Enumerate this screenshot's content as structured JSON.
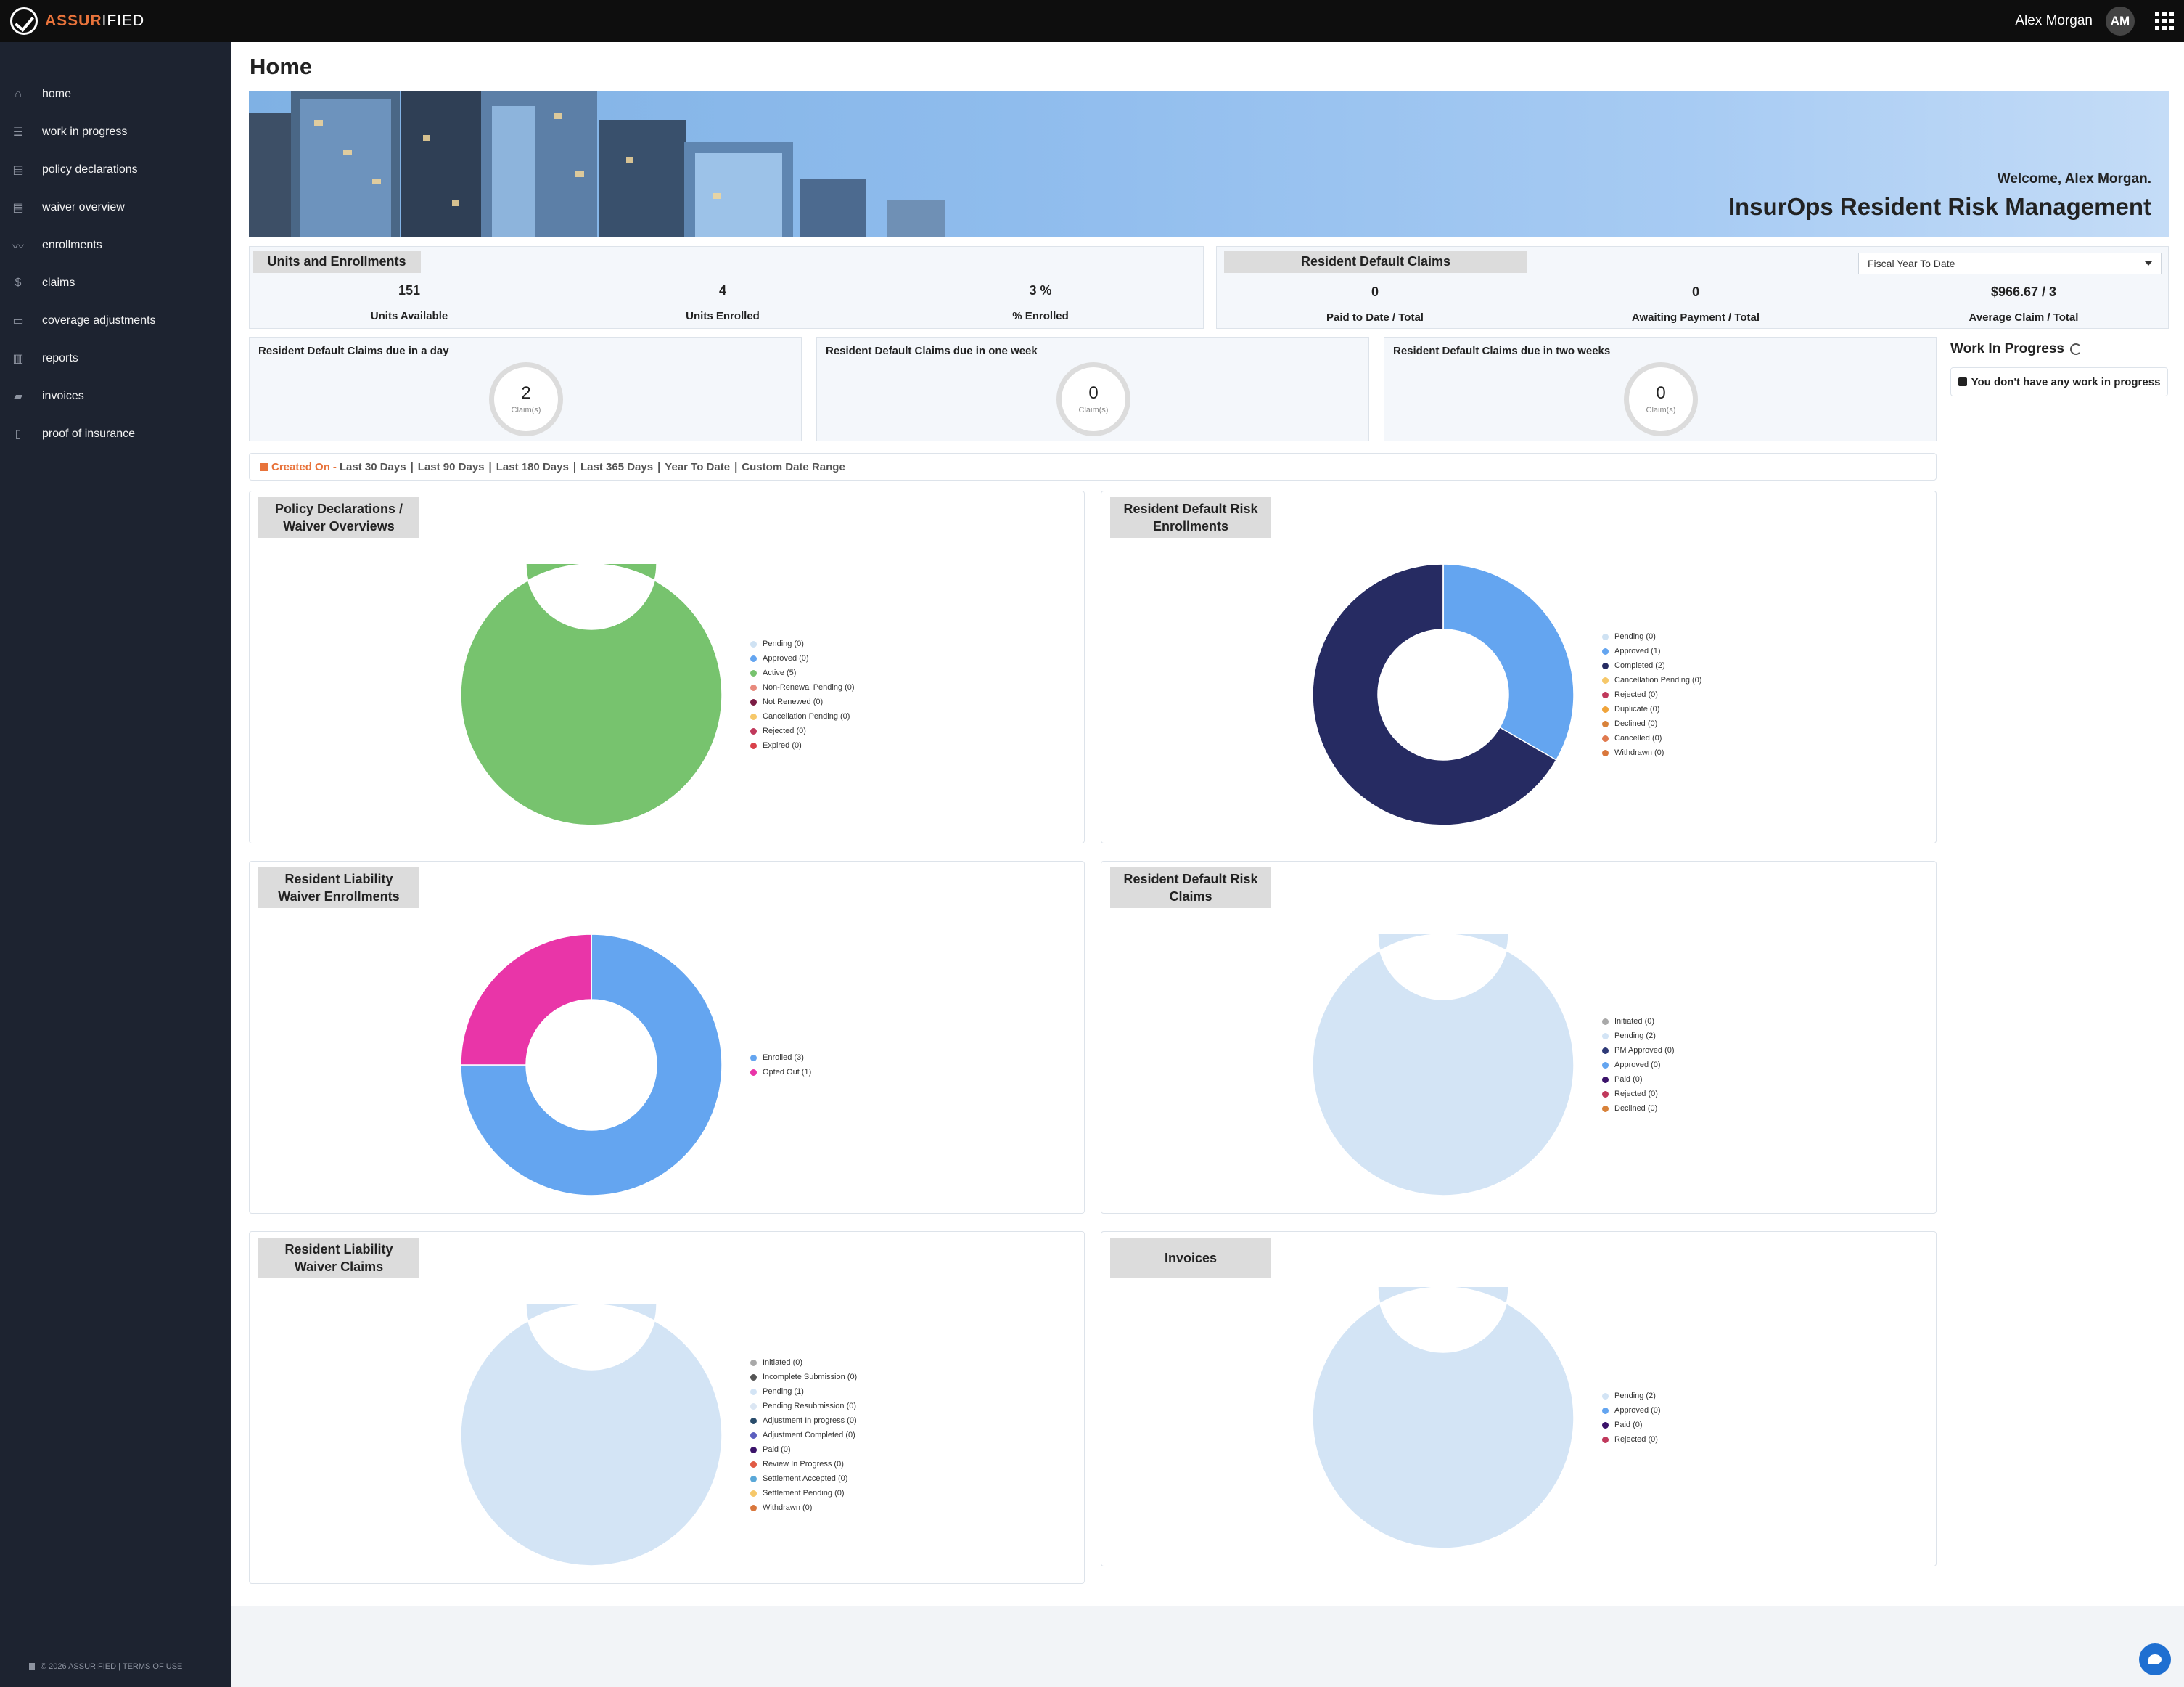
{
  "brand": {
    "part1": "ASSUR",
    "part2": "IFIED"
  },
  "user": {
    "name": "Alex Morgan",
    "initials": "AM"
  },
  "sidebar": {
    "items": [
      {
        "label": "home",
        "icon": "home-icon"
      },
      {
        "label": "work in progress",
        "icon": "list-icon"
      },
      {
        "label": "policy declarations",
        "icon": "document-icon"
      },
      {
        "label": "waiver overview",
        "icon": "document-icon"
      },
      {
        "label": "enrollments",
        "icon": "trend-line-icon"
      },
      {
        "label": "claims",
        "icon": "dollar-icon"
      },
      {
        "label": "coverage adjustments",
        "icon": "card-icon"
      },
      {
        "label": "reports",
        "icon": "bar-chart-icon"
      },
      {
        "label": "invoices",
        "icon": "folder-icon"
      },
      {
        "label": "proof of insurance",
        "icon": "file-icon"
      }
    ],
    "footer": "© 2026 ASSURIFIED | TERMS OF USE"
  },
  "page": {
    "title": "Home"
  },
  "banner": {
    "welcome": "Welcome, Alex Morgan.",
    "title": "InsurOps Resident Risk Management"
  },
  "units": {
    "title": "Units and Enrollments",
    "stats": [
      {
        "value": "151",
        "label": "Units Available"
      },
      {
        "value": "4",
        "label": "Units Enrolled"
      },
      {
        "value": "3 %",
        "label": "% Enrolled"
      }
    ]
  },
  "claims_summary": {
    "title": "Resident Default Claims",
    "period": "Fiscal Year To Date",
    "stats": [
      {
        "value": "0",
        "label": "Paid to Date / Total"
      },
      {
        "value": "0",
        "label": "Awaiting Payment / Total"
      },
      {
        "value": "$966.67 / 3",
        "label": "Average Claim / Total"
      }
    ]
  },
  "due_cards": [
    {
      "title": "Resident Default Claims due in a day",
      "value": "2",
      "unit": "Claim(s)"
    },
    {
      "title": "Resident Default Claims due in one week",
      "value": "0",
      "unit": "Claim(s)"
    },
    {
      "title": "Resident Default Claims due in two weeks",
      "value": "0",
      "unit": "Claim(s)"
    }
  ],
  "wip": {
    "title": "Work In Progress",
    "message": "You don't have any work in progress"
  },
  "filter": {
    "label": "Created On",
    "prefix": "-",
    "options": [
      "Last 30 Days",
      "Last 90 Days",
      "Last 180 Days",
      "Last 365 Days",
      "Year To Date",
      "Custom Date Range"
    ],
    "active": "Year To Date"
  },
  "colors": {
    "accent": "#e8733b",
    "sidebar": "#1d2330",
    "topbar": "#0e0e0e"
  },
  "chart_data": [
    {
      "type": "pie",
      "title": "Policy Declarations / Waiver Overviews",
      "slices": [
        {
          "label": "Pending (0)",
          "value": 0,
          "color": "#cfe2f3"
        },
        {
          "label": "Approved (0)",
          "value": 0,
          "color": "#64a5f0"
        },
        {
          "label": "Active (5)",
          "value": 5,
          "color": "#77c36e"
        },
        {
          "label": "Non-Renewal Pending (0)",
          "value": 0,
          "color": "#e88a7d"
        },
        {
          "label": "Not Renewed (0)",
          "value": 0,
          "color": "#7b1d44"
        },
        {
          "label": "Cancellation Pending (0)",
          "value": 0,
          "color": "#f6c86a"
        },
        {
          "label": "Rejected (0)",
          "value": 0,
          "color": "#c0395c"
        },
        {
          "label": "Expired (0)",
          "value": 0,
          "color": "#d9414a"
        }
      ]
    },
    {
      "type": "pie",
      "title": "Resident Default Risk Enrollments",
      "slices": [
        {
          "label": "Pending (0)",
          "value": 0,
          "color": "#cfe2f3"
        },
        {
          "label": "Approved (1)",
          "value": 1,
          "color": "#64a5f0"
        },
        {
          "label": "Completed (2)",
          "value": 2,
          "color": "#262b62"
        },
        {
          "label": "Cancellation Pending (0)",
          "value": 0,
          "color": "#f6c86a"
        },
        {
          "label": "Rejected (0)",
          "value": 0,
          "color": "#c0395c"
        },
        {
          "label": "Duplicate (0)",
          "value": 0,
          "color": "#f0a43a"
        },
        {
          "label": "Declined (0)",
          "value": 0,
          "color": "#d8823a"
        },
        {
          "label": "Cancelled (0)",
          "value": 0,
          "color": "#e07a4f"
        },
        {
          "label": "Withdrawn (0)",
          "value": 0,
          "color": "#d9773c"
        }
      ]
    },
    {
      "type": "pie",
      "title": "Resident Liability Waiver Enrollments",
      "slices": [
        {
          "label": "Enrolled (3)",
          "value": 3,
          "color": "#64a5f0"
        },
        {
          "label": "Opted Out (1)",
          "value": 1,
          "color": "#e935a8"
        }
      ]
    },
    {
      "type": "pie",
      "title": "Resident Default Risk Claims",
      "slices": [
        {
          "label": "Initiated (0)",
          "value": 0,
          "color": "#a9a9a9"
        },
        {
          "label": "Pending (2)",
          "value": 2,
          "color": "#d3e4f5"
        },
        {
          "label": "PM Approved (0)",
          "value": 0,
          "color": "#2f3a77"
        },
        {
          "label": "Approved (0)",
          "value": 0,
          "color": "#64a5f0"
        },
        {
          "label": "Paid (0)",
          "value": 0,
          "color": "#3b136a"
        },
        {
          "label": "Rejected (0)",
          "value": 0,
          "color": "#c0395c"
        },
        {
          "label": "Declined (0)",
          "value": 0,
          "color": "#d8823a"
        }
      ]
    },
    {
      "type": "pie",
      "title": "Resident Liability Waiver Claims",
      "slices": [
        {
          "label": "Initiated (0)",
          "value": 0,
          "color": "#a9a9a9"
        },
        {
          "label": "Incomplete Submission (0)",
          "value": 0,
          "color": "#555555"
        },
        {
          "label": "Pending (1)",
          "value": 1,
          "color": "#d3e4f5"
        },
        {
          "label": "Pending Resubmission (0)",
          "value": 0,
          "color": "#dbe6f3"
        },
        {
          "label": "Adjustment In progress (0)",
          "value": 0,
          "color": "#2a4c6b"
        },
        {
          "label": "Adjustment Completed (0)",
          "value": 0,
          "color": "#5c5fbf"
        },
        {
          "label": "Paid (0)",
          "value": 0,
          "color": "#3b136a"
        },
        {
          "label": "Review In Progress (0)",
          "value": 0,
          "color": "#e15b45"
        },
        {
          "label": "Settlement Accepted (0)",
          "value": 0,
          "color": "#5aa8d8"
        },
        {
          "label": "Settlement Pending (0)",
          "value": 0,
          "color": "#f6c86a"
        },
        {
          "label": "Withdrawn (0)",
          "value": 0,
          "color": "#d9773c"
        }
      ]
    },
    {
      "type": "pie",
      "title": "Invoices",
      "slices": [
        {
          "label": "Pending (2)",
          "value": 2,
          "color": "#d3e4f5"
        },
        {
          "label": "Approved (0)",
          "value": 0,
          "color": "#64a5f0"
        },
        {
          "label": "Paid (0)",
          "value": 0,
          "color": "#3b136a"
        },
        {
          "label": "Rejected (0)",
          "value": 0,
          "color": "#c0395c"
        }
      ]
    }
  ]
}
